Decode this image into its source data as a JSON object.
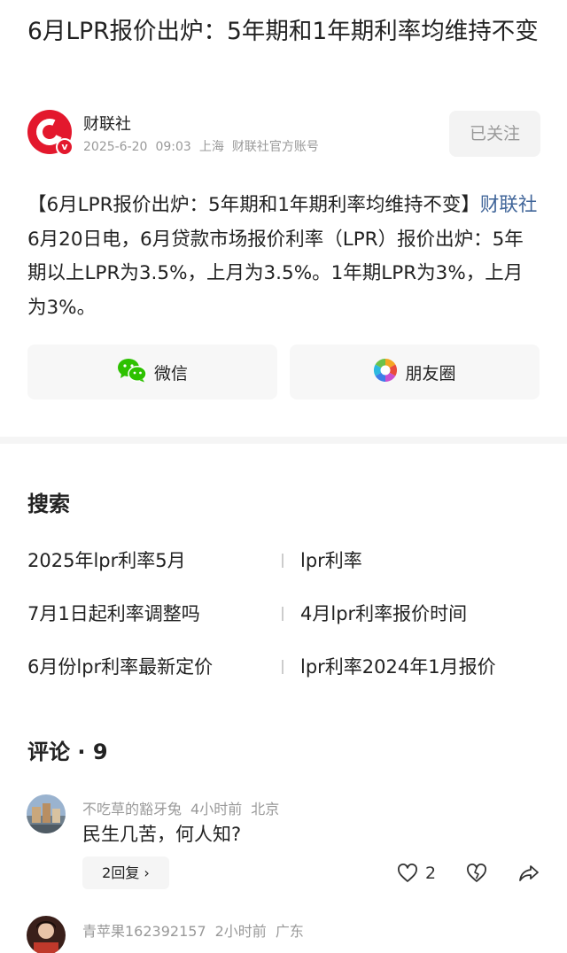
{
  "article": {
    "title": "6月LPR报价出炉：5年期和1年期利率均维持不变",
    "author": {
      "name": "财联社",
      "date": "2025-6-20",
      "time": "09:03",
      "location": "上海",
      "account_type": "财联社官方账号",
      "follow_label": "已关注",
      "logo_letter": "C",
      "verified_badge": "v"
    },
    "body": {
      "intro": "【6月LPR报价出炉：5年期和1年期利率均维持不变】",
      "source_link": "财联社",
      "text": "6月20日电，6月贷款市场报价利率（LPR）报价出炉：5年期以上LPR为3.5%，上月为3.5%。1年期LPR为3%，上月为3%。"
    },
    "share": {
      "wechat_label": "微信",
      "moments_label": "朋友圈"
    }
  },
  "search": {
    "title": "搜索",
    "items": [
      "2025年lpr利率5月",
      "lpr利率",
      "7月1日起利率调整吗",
      "4月lpr利率报价时间",
      "6月份lpr利率最新定价",
      "lpr利率2024年1月报价"
    ]
  },
  "comments": {
    "title": "评论 · 9",
    "list": [
      {
        "user": "不吃草的豁牙兔",
        "time": "4小时前",
        "location": "北京",
        "text": "民生几苦，何人知?",
        "reply_label": "2回复 ›",
        "likes": "2"
      },
      {
        "user": "青苹果162392157",
        "time": "2小时前",
        "location": "广东"
      }
    ]
  },
  "colors": {
    "brand_red": "#e3182d",
    "link_blue": "#406599",
    "wechat_green": "#2dc100",
    "muted_gray": "#999999"
  },
  "icons": [
    "wechat-icon",
    "moments-icon",
    "heart-icon",
    "dislike-heart-icon",
    "share-icon",
    "chevron-right-icon"
  ]
}
